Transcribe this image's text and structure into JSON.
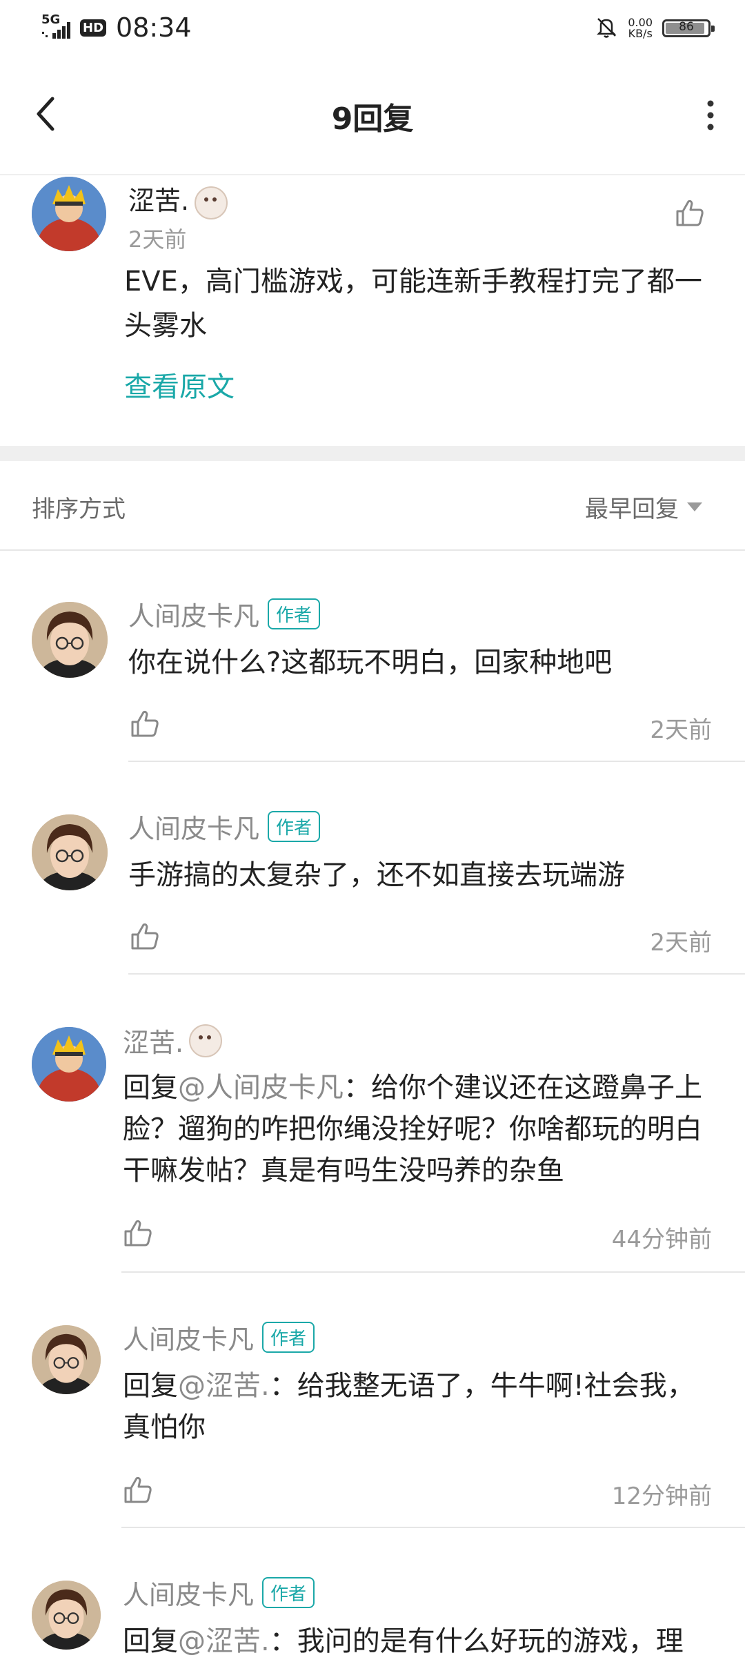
{
  "status_bar": {
    "signal": "5G",
    "hd": "HD",
    "time": "08:34",
    "net_speed_value": "0.00",
    "net_speed_unit": "KB/s",
    "battery": "86"
  },
  "header": {
    "title": "9回复"
  },
  "main_comment": {
    "user": "涩苦.",
    "time": "2天前",
    "text": "EVE，高门槛游戏，可能连新手教程打完了都一头雾水",
    "view_original": "查看原文"
  },
  "sort": {
    "label": "排序方式",
    "value": "最早回复"
  },
  "replies": [
    {
      "user": "人间皮卡凡",
      "tag": "作者",
      "reply_prefix": "",
      "mention": "",
      "text": "你在说什么?这都玩不明白，回家种地吧",
      "time": "2天前"
    },
    {
      "user": "人间皮卡凡",
      "tag": "作者",
      "reply_prefix": "",
      "mention": "",
      "text": "手游搞的太复杂了，还不如直接去玩端游",
      "time": "2天前"
    },
    {
      "user": "涩苦.",
      "tag": "",
      "reply_prefix": "回复",
      "mention": "@人间皮卡凡",
      "text": "：给你个建议还在这蹬鼻子上脸？遛狗的咋把你绳没拴好呢？你啥都玩的明白干嘛发帖？真是有吗生没吗养的杂鱼",
      "time": "44分钟前"
    },
    {
      "user": "人间皮卡凡",
      "tag": "作者",
      "reply_prefix": "回复",
      "mention": "@涩苦.",
      "text": "：给我整无语了，牛牛啊!社会我，真怕你",
      "time": "12分钟前"
    },
    {
      "user": "人间皮卡凡",
      "tag": "作者",
      "reply_prefix": "回复",
      "mention": "@涩苦.",
      "text": "：我问的是有什么好玩的游戏，理",
      "time": ""
    }
  ]
}
